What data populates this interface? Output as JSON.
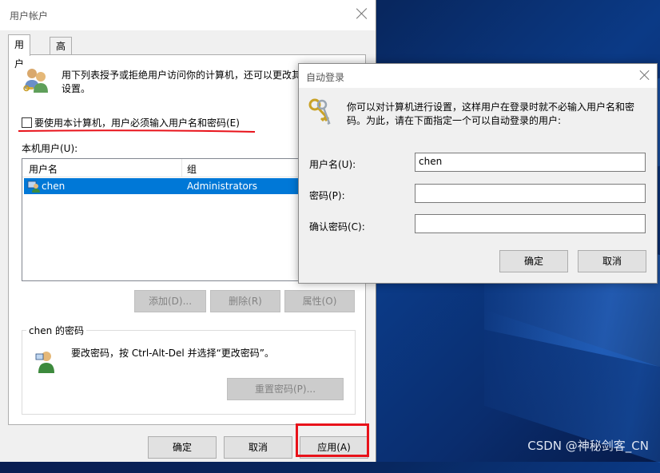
{
  "main_dialog": {
    "title": "用户帐户",
    "tabs": [
      {
        "label": "用户"
      },
      {
        "label": "高级"
      }
    ],
    "intro_text": "用下列表授予或拒绝用户访问你的计算机，还可以更改其密码和其它设置。",
    "require_password_label": "要使用本计算机，用户必须输入用户名和密码(E)",
    "require_password_checked": false,
    "local_users_label": "本机用户(U):",
    "columns": [
      "用户名",
      "组"
    ],
    "rows": [
      {
        "username": "chen",
        "group": "Administrators",
        "selected": true
      }
    ],
    "add_button": "添加(D)...",
    "delete_button": "删除(R)",
    "properties_button": "属性(O)",
    "password_group_label": "chen 的密码",
    "password_text": "要改密码，按 Ctrl-Alt-Del 并选择“更改密码”。",
    "reset_password_button": "重置密码(P)...",
    "ok_button": "确定",
    "cancel_button": "取消",
    "apply_button": "应用(A)"
  },
  "auto_login_dialog": {
    "title": "自动登录",
    "description": "你可以对计算机进行设置，这样用户在登录时就不必输入用户名和密码。为此，请在下面指定一个可以自动登录的用户:",
    "username_label": "用户名(U):",
    "username_value": "chen",
    "password_label": "密码(P):",
    "password_value": "",
    "confirm_password_label": "确认密码(C):",
    "confirm_password_value": "",
    "ok_button": "确定",
    "cancel_button": "取消"
  },
  "watermark": "CSDN @神秘剑客_CN",
  "colors": {
    "selection": "#0078d7",
    "annotation_red": "#e8121a"
  }
}
